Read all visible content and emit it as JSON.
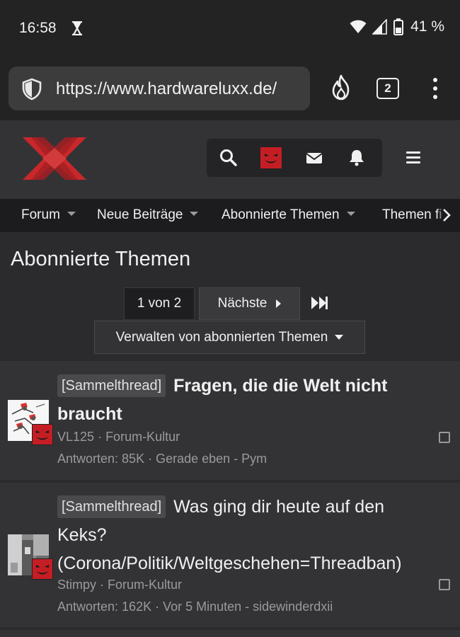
{
  "status": {
    "time": "16:58",
    "battery": "41 %"
  },
  "browser": {
    "url": "https://www.hardwareluxx.de/",
    "tab_count": "2"
  },
  "nav": {
    "items": [
      "Forum",
      "Neue Beiträge",
      "Abonnierte Themen",
      "Themen fi"
    ]
  },
  "page": {
    "title": "Abonnierte Themen",
    "pagination": {
      "current": "1 von 2",
      "next": "Nächste"
    },
    "manage": "Verwalten von abonnierten Themen"
  },
  "threads": [
    {
      "prefix": "[Sammelthread]",
      "title": "Fragen, die die Welt nicht braucht",
      "author": "VL125",
      "forum": "Forum-Kultur",
      "replies": "Antworten: 85K",
      "last": "Gerade eben - Pym"
    },
    {
      "prefix": "[Sammelthread]",
      "title": "Was ging dir heute auf den Keks? (Corona/Politik/Weltgeschehen=Threadban)",
      "author": "Stimpy",
      "forum": "Forum-Kultur",
      "replies": "Antworten: 162K",
      "last": "Vor 5 Minuten - sidewinderdxii"
    }
  ],
  "colors": {
    "logo_red": "#c8282b",
    "badge_red": "#c41e24",
    "background": "#2b2b2e"
  }
}
